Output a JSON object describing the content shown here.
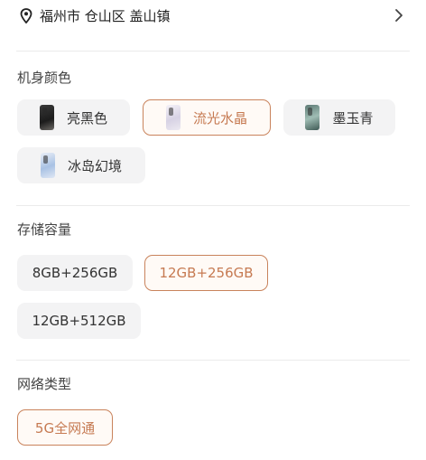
{
  "address": {
    "location_icon": "location-pin-icon",
    "text": "福州市 仓山区 盖山镇",
    "chevron_icon": "chevron-right-icon"
  },
  "color_section": {
    "title": "机身颜色",
    "options": [
      {
        "label": "亮黑色",
        "selected": false,
        "thumb_color": "#2a2a2a"
      },
      {
        "label": "流光水晶",
        "selected": true,
        "thumb_color": "#ddd8e8"
      },
      {
        "label": "墨玉青",
        "selected": false,
        "thumb_color": "#6f8c86"
      },
      {
        "label": "冰岛幻境",
        "selected": false,
        "thumb_color": "#b6cbe8"
      }
    ]
  },
  "storage_section": {
    "title": "存储容量",
    "options": [
      {
        "label": "8GB+256GB",
        "selected": false
      },
      {
        "label": "12GB+256GB",
        "selected": true
      },
      {
        "label": "12GB+512GB",
        "selected": false
      }
    ]
  },
  "network_section": {
    "title": "网络类型",
    "options": [
      {
        "label": "5G全网通",
        "selected": true
      }
    ]
  },
  "colors": {
    "accent": "#c67a52",
    "chip_bg": "#f3f3f4",
    "selected_bg": "#fffaf6"
  }
}
